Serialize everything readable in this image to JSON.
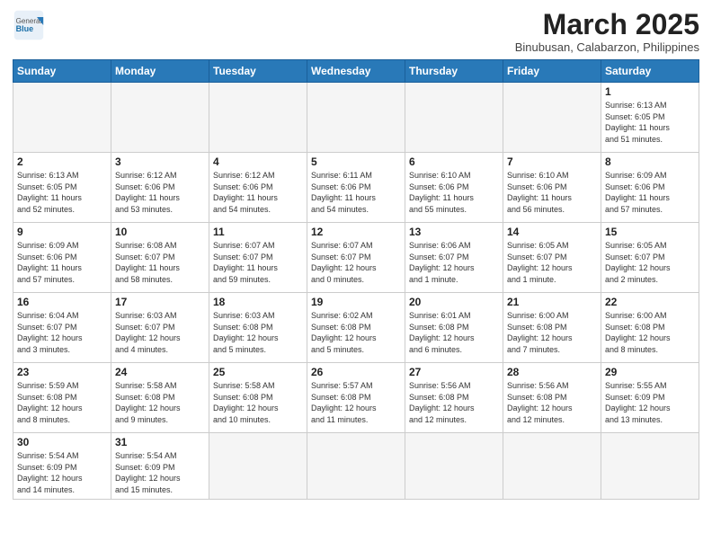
{
  "header": {
    "logo_general": "General",
    "logo_blue": "Blue",
    "month_title": "March 2025",
    "location": "Binubusan, Calabarzon, Philippines"
  },
  "weekdays": [
    "Sunday",
    "Monday",
    "Tuesday",
    "Wednesday",
    "Thursday",
    "Friday",
    "Saturday"
  ],
  "weeks": [
    [
      {
        "day": "",
        "info": ""
      },
      {
        "day": "",
        "info": ""
      },
      {
        "day": "",
        "info": ""
      },
      {
        "day": "",
        "info": ""
      },
      {
        "day": "",
        "info": ""
      },
      {
        "day": "",
        "info": ""
      },
      {
        "day": "1",
        "info": "Sunrise: 6:13 AM\nSunset: 6:05 PM\nDaylight: 11 hours\nand 51 minutes."
      }
    ],
    [
      {
        "day": "2",
        "info": "Sunrise: 6:13 AM\nSunset: 6:05 PM\nDaylight: 11 hours\nand 52 minutes."
      },
      {
        "day": "3",
        "info": "Sunrise: 6:12 AM\nSunset: 6:06 PM\nDaylight: 11 hours\nand 53 minutes."
      },
      {
        "day": "4",
        "info": "Sunrise: 6:12 AM\nSunset: 6:06 PM\nDaylight: 11 hours\nand 54 minutes."
      },
      {
        "day": "5",
        "info": "Sunrise: 6:11 AM\nSunset: 6:06 PM\nDaylight: 11 hours\nand 54 minutes."
      },
      {
        "day": "6",
        "info": "Sunrise: 6:10 AM\nSunset: 6:06 PM\nDaylight: 11 hours\nand 55 minutes."
      },
      {
        "day": "7",
        "info": "Sunrise: 6:10 AM\nSunset: 6:06 PM\nDaylight: 11 hours\nand 56 minutes."
      },
      {
        "day": "8",
        "info": "Sunrise: 6:09 AM\nSunset: 6:06 PM\nDaylight: 11 hours\nand 57 minutes."
      }
    ],
    [
      {
        "day": "9",
        "info": "Sunrise: 6:09 AM\nSunset: 6:06 PM\nDaylight: 11 hours\nand 57 minutes."
      },
      {
        "day": "10",
        "info": "Sunrise: 6:08 AM\nSunset: 6:07 PM\nDaylight: 11 hours\nand 58 minutes."
      },
      {
        "day": "11",
        "info": "Sunrise: 6:07 AM\nSunset: 6:07 PM\nDaylight: 11 hours\nand 59 minutes."
      },
      {
        "day": "12",
        "info": "Sunrise: 6:07 AM\nSunset: 6:07 PM\nDaylight: 12 hours\nand 0 minutes."
      },
      {
        "day": "13",
        "info": "Sunrise: 6:06 AM\nSunset: 6:07 PM\nDaylight: 12 hours\nand 1 minute."
      },
      {
        "day": "14",
        "info": "Sunrise: 6:05 AM\nSunset: 6:07 PM\nDaylight: 12 hours\nand 1 minute."
      },
      {
        "day": "15",
        "info": "Sunrise: 6:05 AM\nSunset: 6:07 PM\nDaylight: 12 hours\nand 2 minutes."
      }
    ],
    [
      {
        "day": "16",
        "info": "Sunrise: 6:04 AM\nSunset: 6:07 PM\nDaylight: 12 hours\nand 3 minutes."
      },
      {
        "day": "17",
        "info": "Sunrise: 6:03 AM\nSunset: 6:07 PM\nDaylight: 12 hours\nand 4 minutes."
      },
      {
        "day": "18",
        "info": "Sunrise: 6:03 AM\nSunset: 6:08 PM\nDaylight: 12 hours\nand 5 minutes."
      },
      {
        "day": "19",
        "info": "Sunrise: 6:02 AM\nSunset: 6:08 PM\nDaylight: 12 hours\nand 5 minutes."
      },
      {
        "day": "20",
        "info": "Sunrise: 6:01 AM\nSunset: 6:08 PM\nDaylight: 12 hours\nand 6 minutes."
      },
      {
        "day": "21",
        "info": "Sunrise: 6:00 AM\nSunset: 6:08 PM\nDaylight: 12 hours\nand 7 minutes."
      },
      {
        "day": "22",
        "info": "Sunrise: 6:00 AM\nSunset: 6:08 PM\nDaylight: 12 hours\nand 8 minutes."
      }
    ],
    [
      {
        "day": "23",
        "info": "Sunrise: 5:59 AM\nSunset: 6:08 PM\nDaylight: 12 hours\nand 8 minutes."
      },
      {
        "day": "24",
        "info": "Sunrise: 5:58 AM\nSunset: 6:08 PM\nDaylight: 12 hours\nand 9 minutes."
      },
      {
        "day": "25",
        "info": "Sunrise: 5:58 AM\nSunset: 6:08 PM\nDaylight: 12 hours\nand 10 minutes."
      },
      {
        "day": "26",
        "info": "Sunrise: 5:57 AM\nSunset: 6:08 PM\nDaylight: 12 hours\nand 11 minutes."
      },
      {
        "day": "27",
        "info": "Sunrise: 5:56 AM\nSunset: 6:08 PM\nDaylight: 12 hours\nand 12 minutes."
      },
      {
        "day": "28",
        "info": "Sunrise: 5:56 AM\nSunset: 6:08 PM\nDaylight: 12 hours\nand 12 minutes."
      },
      {
        "day": "29",
        "info": "Sunrise: 5:55 AM\nSunset: 6:09 PM\nDaylight: 12 hours\nand 13 minutes."
      }
    ],
    [
      {
        "day": "30",
        "info": "Sunrise: 5:54 AM\nSunset: 6:09 PM\nDaylight: 12 hours\nand 14 minutes."
      },
      {
        "day": "31",
        "info": "Sunrise: 5:54 AM\nSunset: 6:09 PM\nDaylight: 12 hours\nand 15 minutes."
      },
      {
        "day": "",
        "info": ""
      },
      {
        "day": "",
        "info": ""
      },
      {
        "day": "",
        "info": ""
      },
      {
        "day": "",
        "info": ""
      },
      {
        "day": "",
        "info": ""
      }
    ]
  ]
}
